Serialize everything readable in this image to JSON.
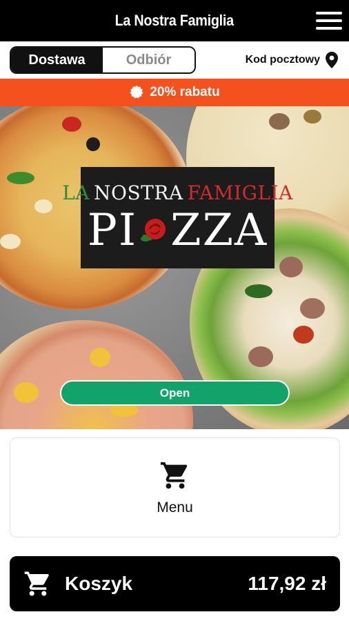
{
  "header": {
    "title": "La Nostra Famiglia",
    "menu_icon": "hamburger-icon"
  },
  "mode": {
    "delivery_label": "Dostawa",
    "pickup_label": "Odbiór",
    "selected": "Dostawa"
  },
  "postcode": {
    "label": "Kod pocztowy",
    "icon": "location-pin-icon"
  },
  "promo": {
    "text": "20% rabatu",
    "icon": "discount-badge-icon",
    "color": "#f4511e"
  },
  "hero": {
    "logo": {
      "line_la": "LA",
      "line_nostra": "NOSTRA",
      "line_famiglia": "FAMIGLIA",
      "word_pi": "PI",
      "word_zza": "ZZA"
    },
    "status_label": "Open",
    "status_color": "#12a36a"
  },
  "menu_card": {
    "label": "Menu",
    "icon": "shopping-cart-icon"
  },
  "cart": {
    "label": "Koszyk",
    "total": "117,92 zł",
    "icon": "shopping-cart-icon"
  }
}
